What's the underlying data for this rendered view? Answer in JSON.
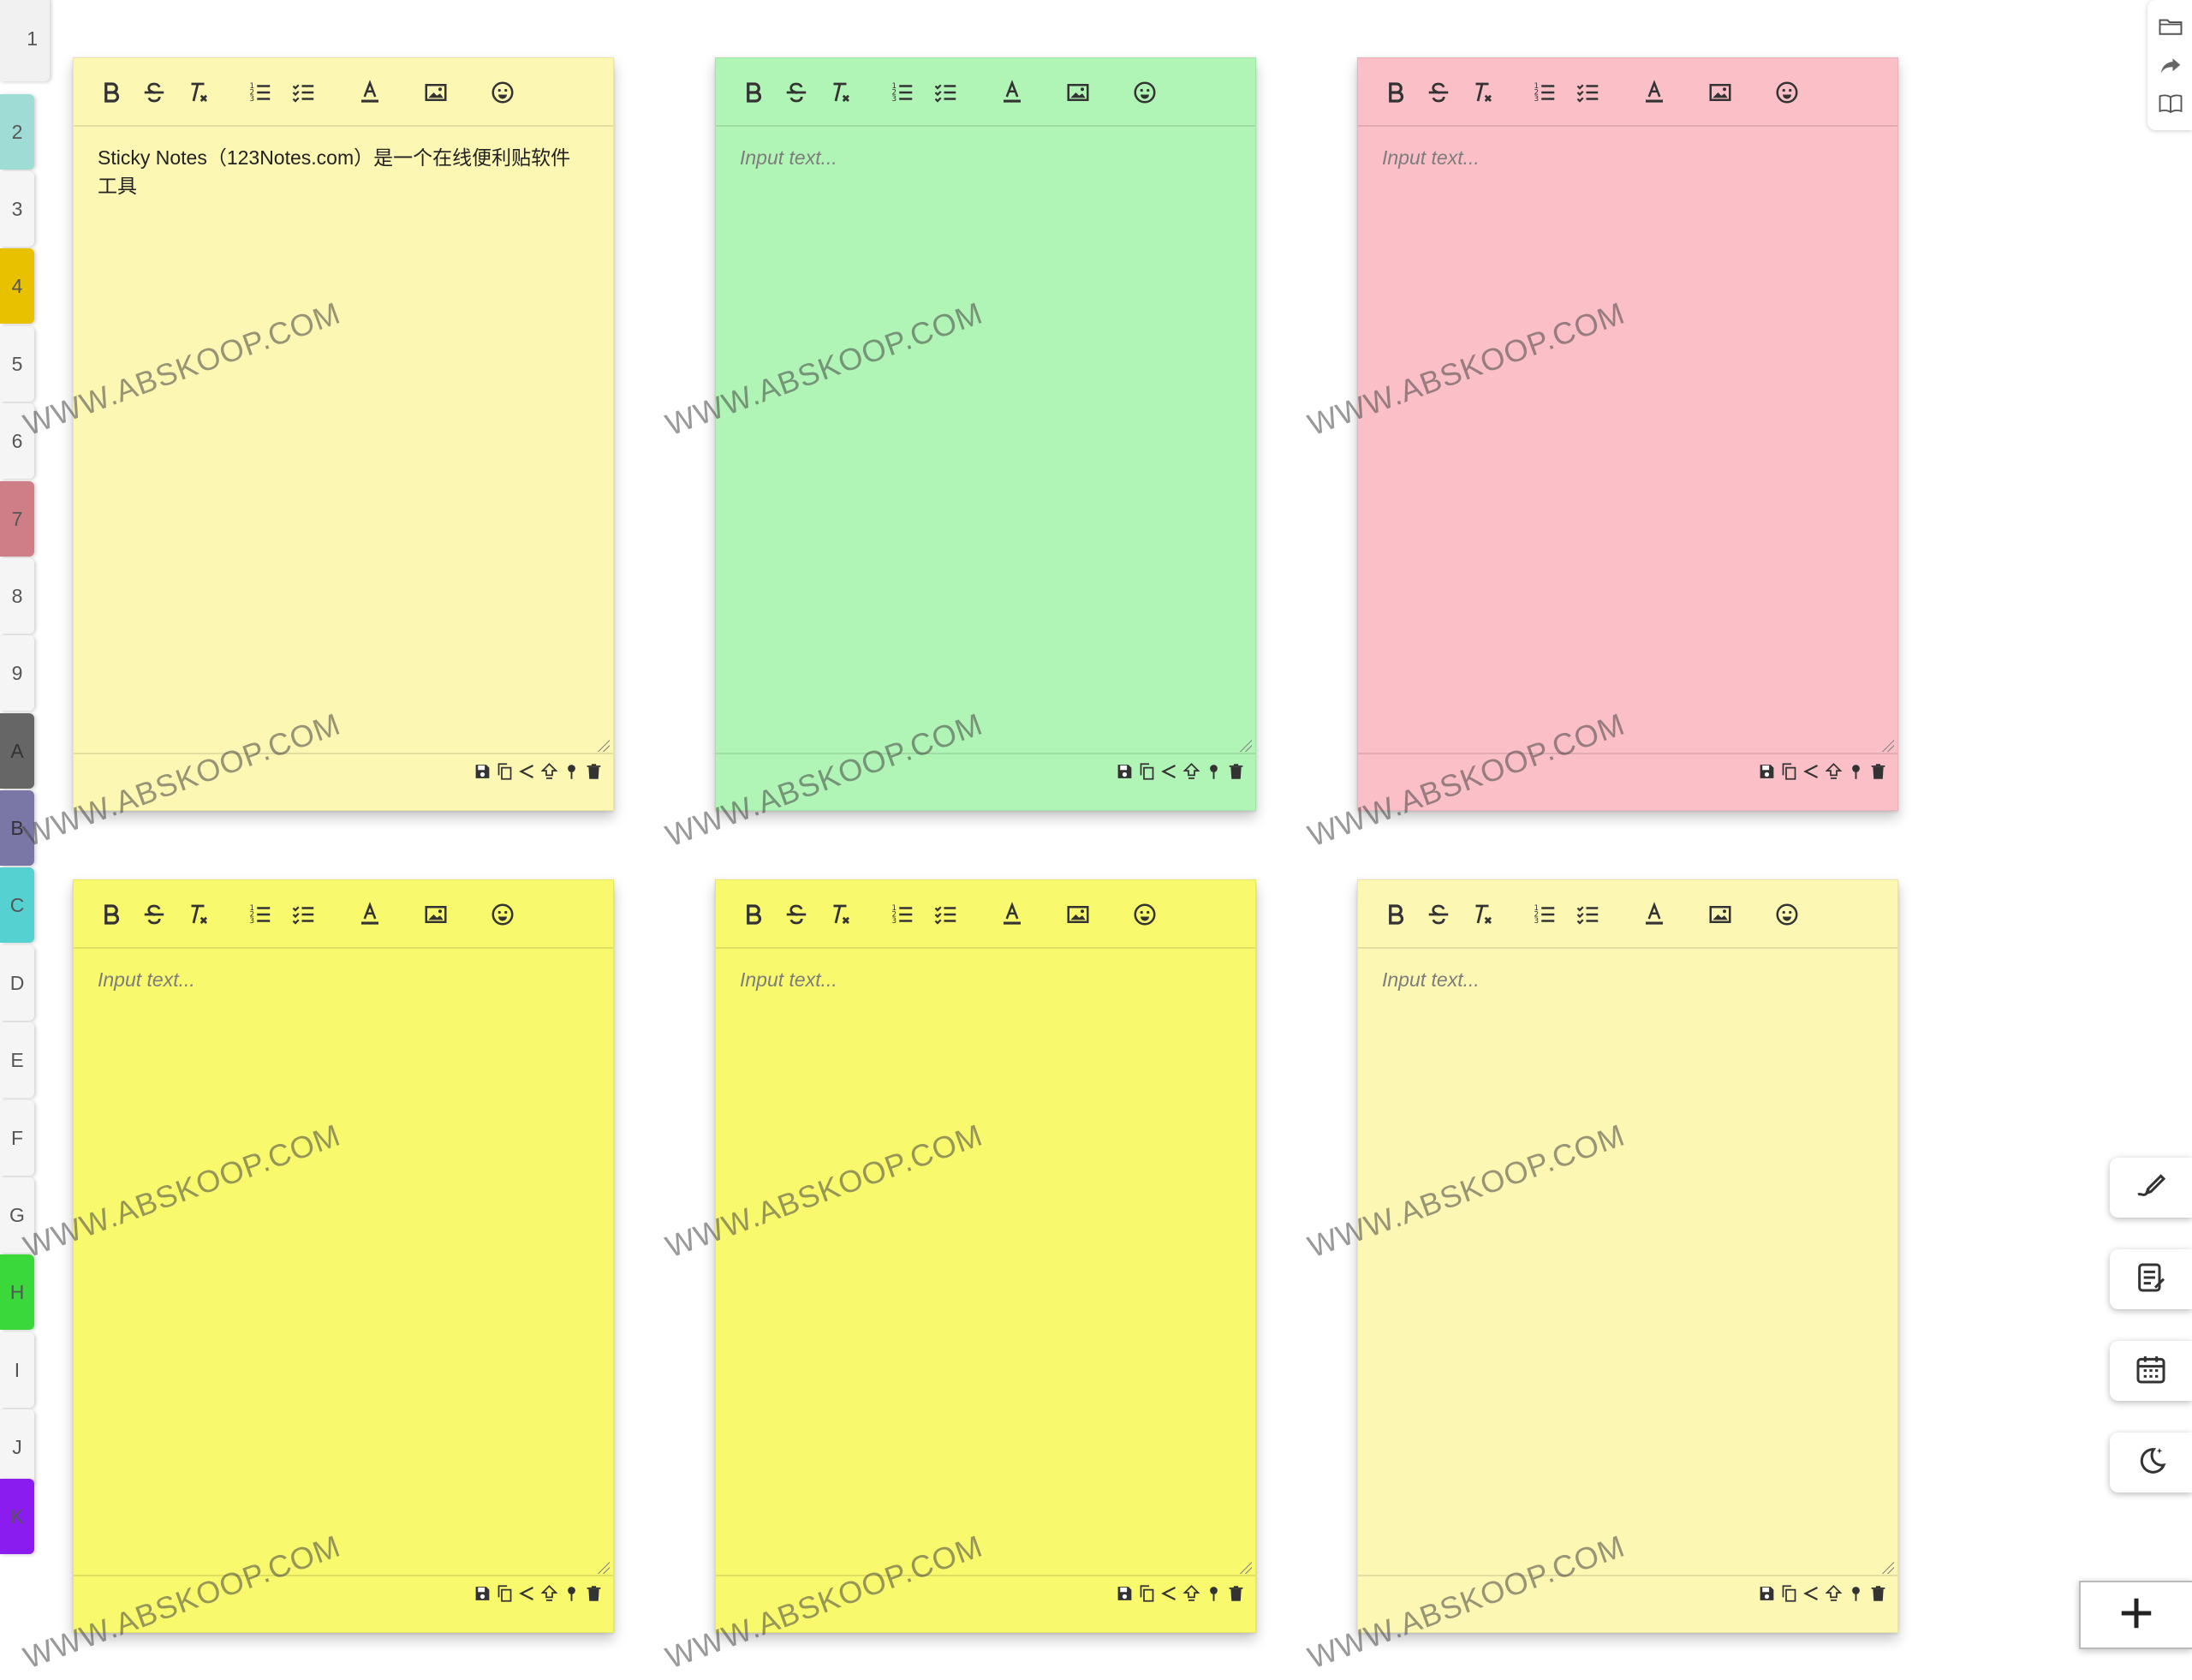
{
  "tabs": [
    {
      "label": "1",
      "color": "#f1f1f1"
    },
    {
      "label": "2",
      "color": "#9fdcd6"
    },
    {
      "label": "3",
      "color": "#f5f5f5"
    },
    {
      "label": "4",
      "color": "#e8c100"
    },
    {
      "label": "5",
      "color": "#f5f5f5"
    },
    {
      "label": "6",
      "color": "#f5f5f5"
    },
    {
      "label": "7",
      "color": "#cf7e88"
    },
    {
      "label": "8",
      "color": "#f5f5f5"
    },
    {
      "label": "9",
      "color": "#f5f5f5"
    },
    {
      "label": "A",
      "color": "#666666"
    },
    {
      "label": "B",
      "color": "#7a77a7"
    },
    {
      "label": "C",
      "color": "#55d1d1"
    },
    {
      "label": "D",
      "color": "#f5f5f5"
    },
    {
      "label": "E",
      "color": "#f5f5f5"
    },
    {
      "label": "F",
      "color": "#f5f5f5"
    },
    {
      "label": "G",
      "color": "#f5f5f5"
    },
    {
      "label": "H",
      "color": "#3ad83a"
    },
    {
      "label": "I",
      "color": "#f5f5f5"
    },
    {
      "label": "J",
      "color": "#f5f5f5"
    },
    {
      "label": "K",
      "color": "#8a1cf0"
    }
  ],
  "toolbar_icons": [
    "bold-icon",
    "strikethrough-icon",
    "clear-format-icon",
    "ordered-list-icon",
    "checklist-icon",
    "text-color-icon",
    "image-icon",
    "emoji-icon"
  ],
  "footer_icons": [
    "save-icon",
    "copy-icon",
    "share-icon",
    "export-icon",
    "pin-icon",
    "delete-icon"
  ],
  "notes": [
    {
      "color": "#fdf7b4",
      "text": "Sticky Notes（123Notes.com）是一个在线便利贴软件工具",
      "placeholder": "Input text..."
    },
    {
      "color": "#b1f5b6",
      "text": "",
      "placeholder": "Input text..."
    },
    {
      "color": "#fbbfc8",
      "text": "",
      "placeholder": "Input text..."
    },
    {
      "color": "#f9f96e",
      "text": "",
      "placeholder": "Input text..."
    },
    {
      "color": "#f9f96e",
      "text": "",
      "placeholder": "Input text..."
    },
    {
      "color": "#fdf7b4",
      "text": "",
      "placeholder": "Input text..."
    }
  ],
  "watermark": "WWW.ABSKOOP.COM",
  "side_panel_icons": [
    "folder-icon",
    "share-arrow-icon",
    "book-icon"
  ],
  "side_buttons": [
    "handwriting-icon",
    "notes-list-icon",
    "calendar-icon",
    "night-mode-icon"
  ],
  "add_button_icon": "plus-icon"
}
